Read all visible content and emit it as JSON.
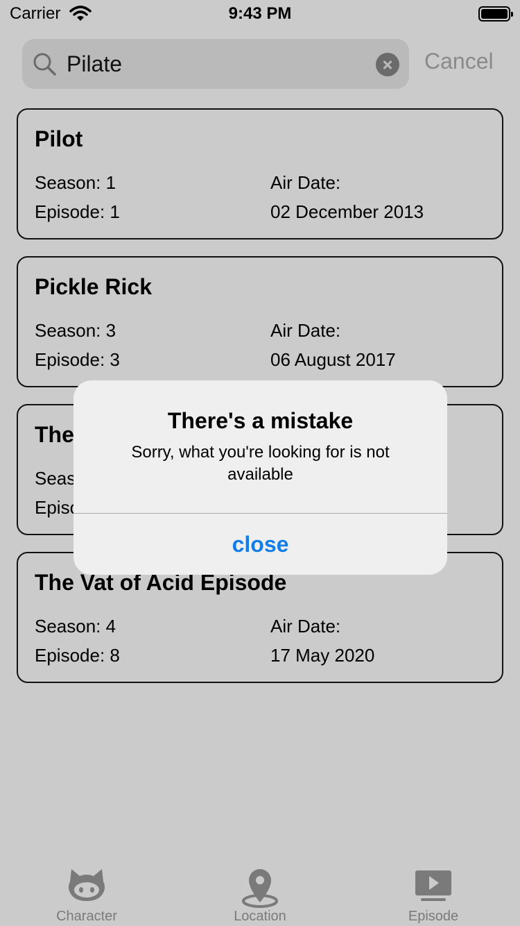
{
  "status_bar": {
    "carrier": "Carrier",
    "time": "9:43 PM"
  },
  "search": {
    "query": "Pilate",
    "cancel_label": "Cancel"
  },
  "episodes": [
    {
      "title": "Pilot",
      "season": "Season: 1",
      "episode": "Episode: 1",
      "air_label": "Air Date:",
      "air_date": "02 December 2013"
    },
    {
      "title": "Pickle Rick",
      "season": "Season: 3",
      "episode": "Episode: 3",
      "air_label": "Air Date:",
      "air_date": "06 August 2017"
    },
    {
      "title": "The",
      "season": "Seas",
      "episode": "Episo",
      "air_label": "",
      "air_date": ""
    },
    {
      "title": "The Vat of Acid Episode",
      "season": "Season: 4",
      "episode": "Episode: 8",
      "air_label": "Air Date:",
      "air_date": "17 May 2020"
    }
  ],
  "alert": {
    "title": "There's a mistake",
    "message": "Sorry, what you're looking for is not available",
    "close_label": "close"
  },
  "tabs": [
    {
      "label": "Character",
      "icon": "github-cat-icon"
    },
    {
      "label": "Location",
      "icon": "location-pin-icon"
    },
    {
      "label": "Episode",
      "icon": "tv-play-icon"
    }
  ],
  "colors": {
    "background": "#cbcbcb",
    "alert_bg": "#efefef",
    "accent": "#137ee8",
    "tab_inactive": "#7a7a7a"
  }
}
